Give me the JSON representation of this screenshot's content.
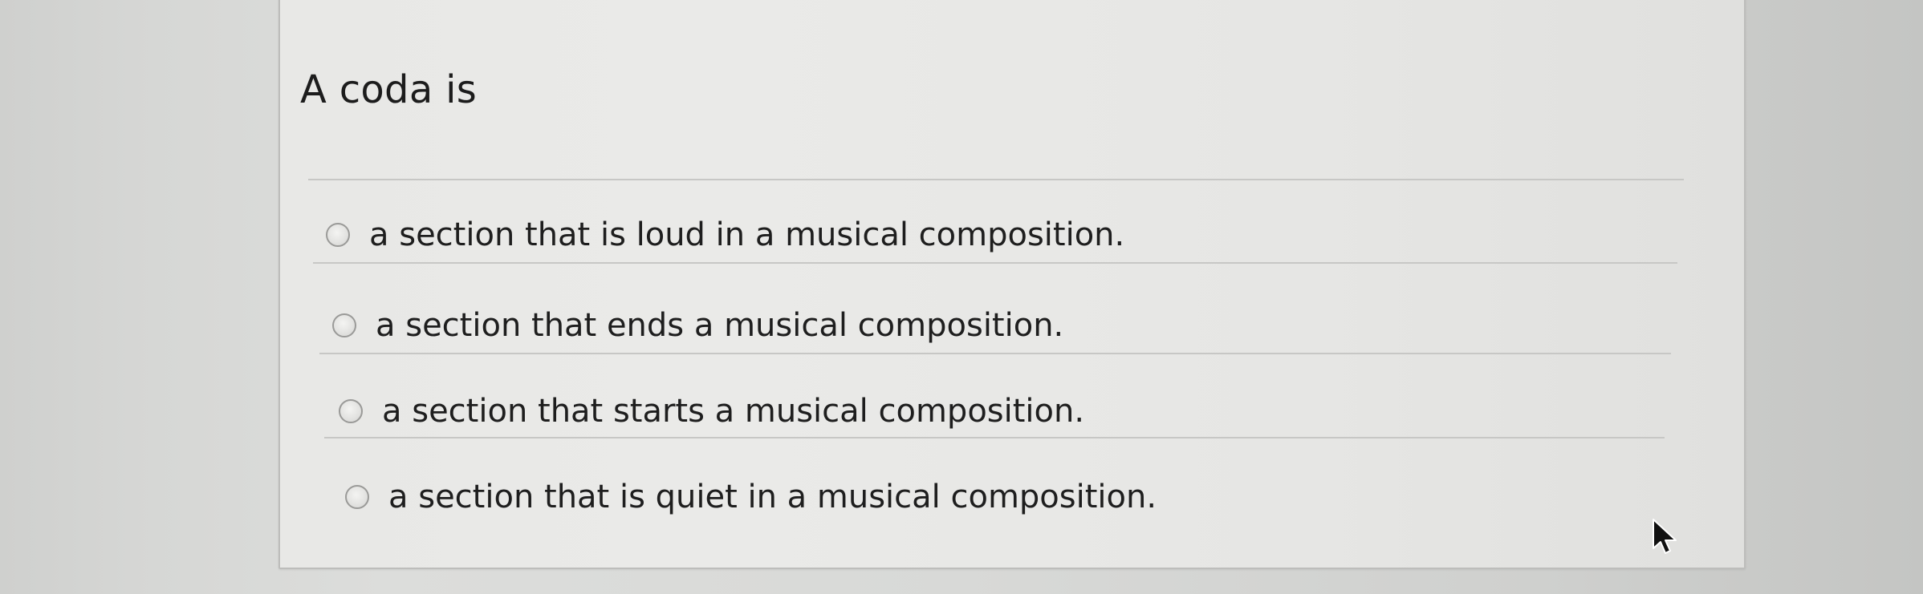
{
  "question": {
    "text": "A coda is"
  },
  "options": [
    {
      "label": "a section that is loud in a musical composition.",
      "selected": false
    },
    {
      "label": "a section that ends a musical composition.",
      "selected": false
    },
    {
      "label": "a section that starts a musical composition.",
      "selected": false
    },
    {
      "label": "a section that is quiet in a musical composition.",
      "selected": false
    }
  ],
  "icons": {
    "radio": "radio-button-icon",
    "cursor": "mouse-pointer-icon"
  },
  "colors": {
    "card_background": "#e8e8e6",
    "text": "#1c1c1c",
    "divider": "#c7c7c5",
    "radio_border": "#9a9a98"
  }
}
